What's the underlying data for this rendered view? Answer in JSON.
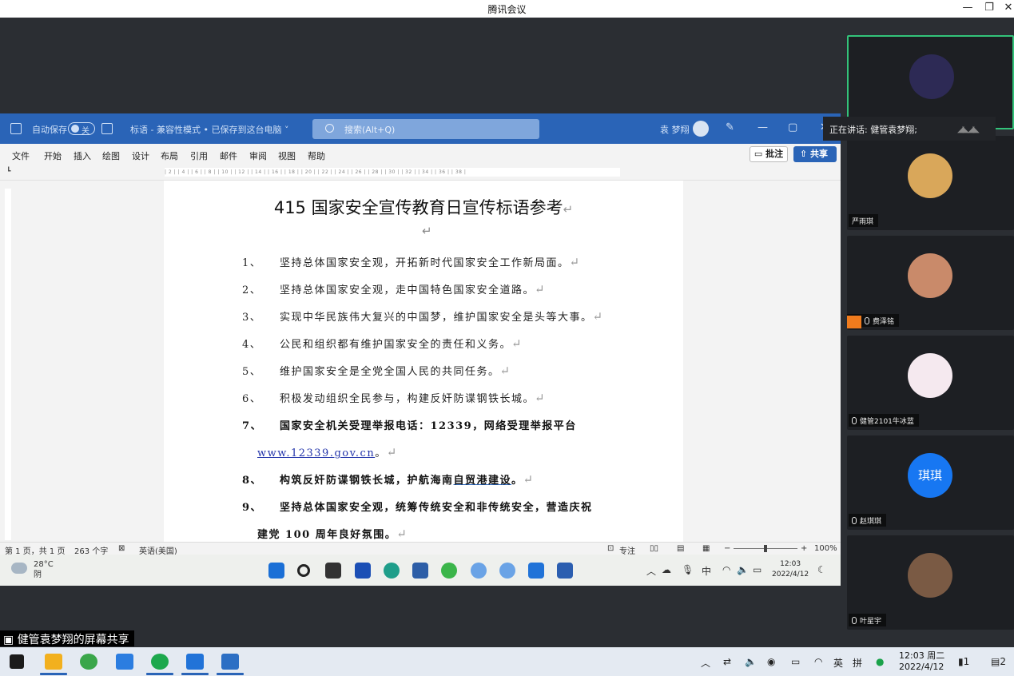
{
  "meeting": {
    "title": "腾讯会议",
    "speaking": "正在讲话: 健管袁梦翔;",
    "share_label": "健管袁梦翔的屏幕共享"
  },
  "word": {
    "autosave_label": "自动保存",
    "autosave_state": "关",
    "doc_name": "标语 - 兼容性模式 • 已保存到这台电脑 ˅",
    "search_placeholder": "搜索(Alt+Q)",
    "user_name": "袁 梦翔",
    "tabs": [
      "文件",
      "开始",
      "插入",
      "绘图",
      "设计",
      "布局",
      "引用",
      "邮件",
      "审阅",
      "视图",
      "帮助"
    ],
    "comment_label": "批注",
    "share_label": "共享",
    "ruler_text": "| 2 |  | 4 |  | 6 |  | 8 |  | 10 |  | 12 |  | 14 |  | 16 |  | 18 |  | 20 |  | 22 |  | 24 |  | 26 |  | 28 |  | 30 |  | 32 |  | 34 |  | 36 |  | 38 |",
    "doc_title": "415 国家安全宣传教育日宣传标语参考",
    "para_mark": "↵",
    "items": [
      {
        "num": "1、",
        "text": "坚持总体国家安全观，开拓新时代国家安全工作新局面。"
      },
      {
        "num": "2、",
        "text": "坚持总体国家安全观，走中国特色国家安全道路。"
      },
      {
        "num": "3、",
        "text": "实现中华民族伟大复兴的中国梦，维护国家安全是头等大事。"
      },
      {
        "num": "4、",
        "text": "公民和组织都有维护国家安全的责任和义务。"
      },
      {
        "num": "5、",
        "text": "维护国家安全是全党全国人民的共同任务。"
      },
      {
        "num": "6、",
        "text": "积极发动组织全民参与，构建反奸防谍钢铁长城。"
      },
      {
        "num": "7、",
        "text": "国家安全机关受理举报电话：12339，网络受理举报平台"
      },
      {
        "num": "8、",
        "text_a": "构筑反奸防谍钢铁长城，护航海南",
        "text_b": "自贸港建设",
        "text_c": "。"
      },
      {
        "num": "9、",
        "text": "坚持总体国家安全观，统筹传统安全和非传统安全，营造庆祝"
      }
    ],
    "item7_link": "www.12339.gov.cn",
    "item7_tail": "。",
    "item9_cont": "建党 100 周年良好氛围。",
    "status": {
      "page": "第 1 页，共 1 页",
      "words": "263 个字",
      "lang": "英语(美国)",
      "focus": "专注",
      "zoom": "100%"
    }
  },
  "shared_taskbar": {
    "temp": "28°C",
    "weather": "阴",
    "ime": "中",
    "time": "12:03",
    "date": "2022/4/12"
  },
  "participants": [
    {
      "name": "",
      "active": true
    },
    {
      "name": "严雨琪"
    },
    {
      "name": "费泽铭"
    },
    {
      "name": "健管2101牛冰蓝"
    },
    {
      "name": "赵琪琪",
      "avatar_text": "琪琪"
    },
    {
      "name": "叶星宇"
    }
  ],
  "host_taskbar": {
    "ime1": "英",
    "ime2": "拼",
    "time": "12:03 周二",
    "date": "2022/4/12",
    "badge1": "1",
    "badge2": "2"
  }
}
